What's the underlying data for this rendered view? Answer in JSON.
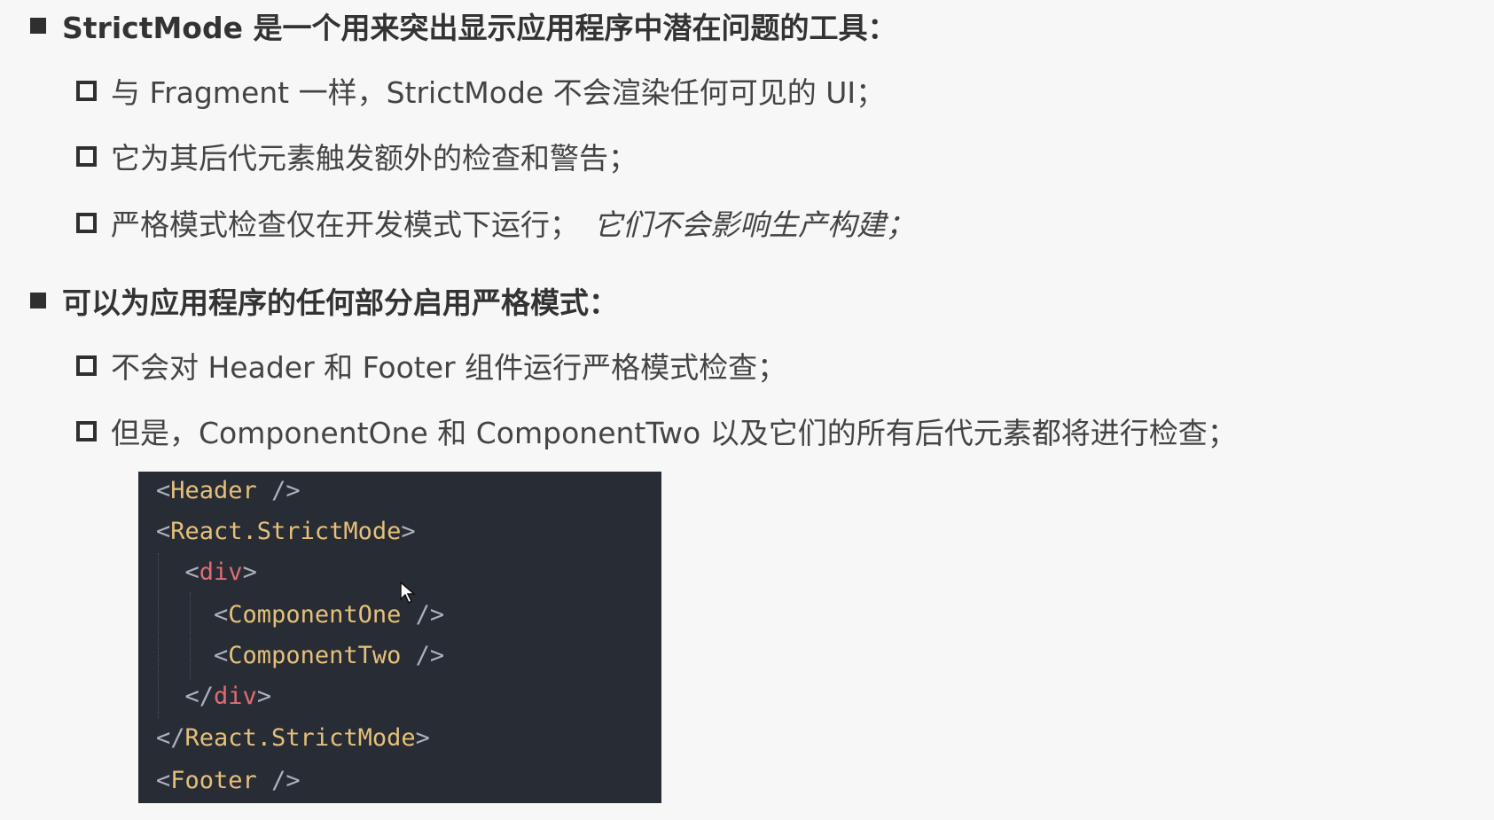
{
  "sections": [
    {
      "heading": "StrictMode 是一个用来突出显示应用程序中潜在问题的工具：",
      "items": [
        "与 Fragment 一样，StrictMode 不会渲染任何可见的 UI；",
        "它为其后代元素触发额外的检查和警告；",
        "严格模式检查仅在开发模式下运行；"
      ],
      "item3_italic": "它们不会影响生产构建；"
    },
    {
      "heading": "可以为应用程序的任何部分启用严格模式：",
      "items": [
        "不会对 Header 和 Footer 组件运行严格模式检查；",
        "但是，ComponentOne 和 ComponentTwo 以及它们的所有后代元素都将进行检查；"
      ]
    }
  ],
  "code": {
    "lines": [
      {
        "open": "<",
        "name": "Header",
        "close": " />"
      },
      {
        "open": "<",
        "name": "React.StrictMode",
        "close": ">"
      },
      {
        "indent": "  ",
        "open": "<",
        "name": "div",
        "close": ">"
      },
      {
        "indent": "    ",
        "open": "<",
        "name": "ComponentOne",
        "close": " />"
      },
      {
        "indent": "    ",
        "open": "<",
        "name": "ComponentTwo",
        "close": " />"
      },
      {
        "indent": "  ",
        "open": "</",
        "name": "div",
        "close": ">"
      },
      {
        "open": "</",
        "name": "React.StrictMode",
        "close": ">"
      },
      {
        "open": "<",
        "name": "Footer",
        "close": " />"
      }
    ]
  },
  "colors": {
    "code_background": "#282c34",
    "component_name": "#e5c07b",
    "html_tag": "#e06c75",
    "punctuation": "#abb2bf"
  }
}
